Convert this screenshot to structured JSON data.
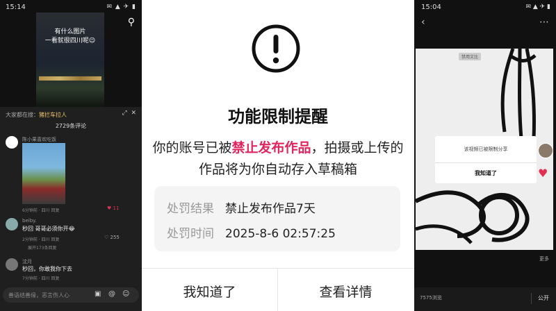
{
  "left": {
    "status_time": "15:14",
    "status_icons": "✉ ▲ ✈ ▮",
    "video_caption_line1": "有什么图片",
    "video_caption_line2": "一看就很四川呢😉",
    "everyone_prefix": "大家都在搜：",
    "everyone_highlight": "猪拦车拉人",
    "comment_count": "2729条评论",
    "comments": [
      {
        "name": "陈小果喜欢吃饭",
        "text": "",
        "meta": "6分钟前 · 四川  回复",
        "likes": "11"
      },
      {
        "name": "beiby.",
        "text": "秒回 哥哥必须你开😂",
        "meta": "2分钟前 · 四川  回复",
        "likes": "255",
        "expand": "展开173条回复"
      },
      {
        "name": "沈月",
        "text": "秒回，你敢我你下去",
        "meta": "7分钟前 · 四川  回复",
        "likes": ""
      }
    ],
    "input_placeholder": "善语结善缘，恶言伤人心"
  },
  "center": {
    "title": "功能限制提醒",
    "message_part1": "你的账号已被",
    "message_highlight": "禁止发布作品",
    "message_part2": "，拍摄或上传的作品将为你自动存入草稿箱",
    "result_label": "处罚结果",
    "result_value": "禁止发布作品7天",
    "time_label": "处罚时间",
    "time_value": "2025-8-6 02:57:25",
    "btn_ok": "我知道了",
    "btn_detail": "查看详情",
    "accent_color": "#e0245e"
  },
  "right": {
    "status_time": "15:04",
    "status_icons": "✉ ▲ ✈ ▮",
    "tag": "禁用文比",
    "dialog_text": "该视频已被限制分享",
    "dialog_button": "我知道了",
    "more_label": "更多",
    "bottom_count": "7575浏览",
    "bottom_public": "公开"
  }
}
